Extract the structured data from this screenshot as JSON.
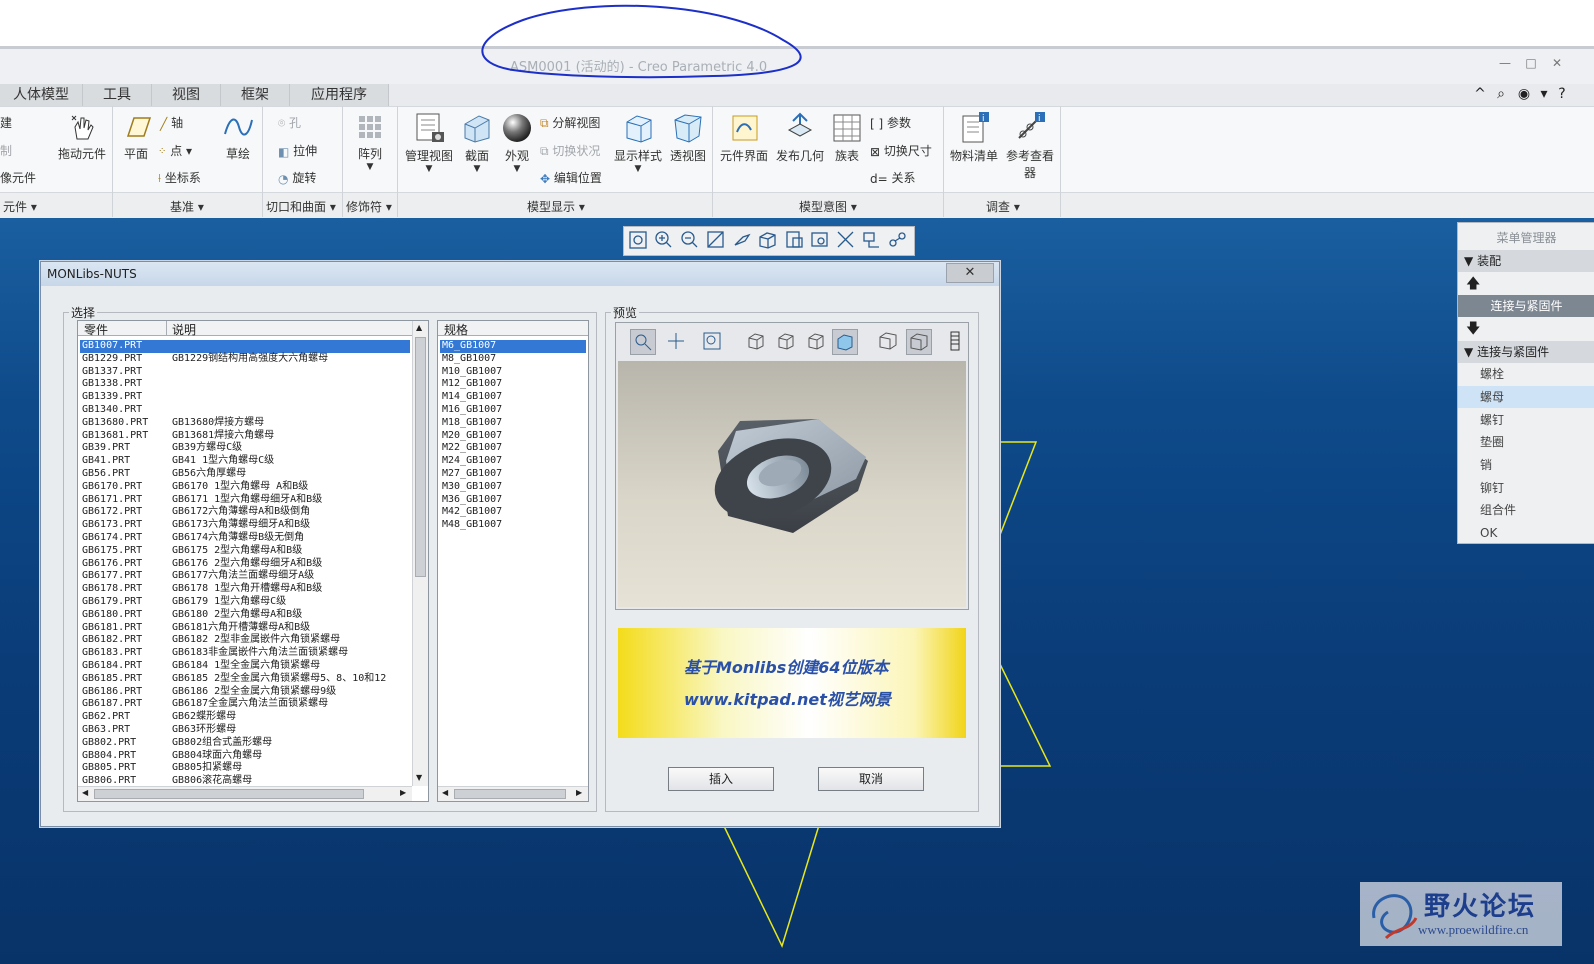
{
  "window": {
    "title": "ASM0001 (活动的) - Creo Parametric 4.0",
    "controls": [
      "—",
      "□",
      "✕"
    ]
  },
  "tabs": [
    "人体模型",
    "工具",
    "视图",
    "框架",
    "应用程序"
  ],
  "right_tools": [
    "^",
    "⌕",
    "◉",
    "▾",
    "?"
  ],
  "ribbon": {
    "left_items": [
      "创建",
      "复制",
      "镜像元件"
    ],
    "group_element": "元件",
    "drag": "拖动元件",
    "plane": "平面",
    "axis": "轴",
    "point": "点",
    "csys": "坐标系",
    "sketch": "草绘",
    "group_datum": "基准",
    "hole": "孔",
    "extrude": "拉伸",
    "revolve": "旋转",
    "group_cut": "切口和曲面",
    "pattern": "阵列",
    "group_modifier": "修饰符",
    "manage_views": "管理视图",
    "section": "截面",
    "appearance": "外观",
    "explode": "分解视图",
    "toggle_status": "切换状况",
    "edit_pos": "编辑位置",
    "display_style": "显示样式",
    "perspective": "透视图",
    "group_display": "模型显示",
    "comp_interface": "元件界面",
    "publish_geom": "发布几何",
    "family_table": "族表",
    "params": "参数",
    "switch_dims": "切换尺寸",
    "relations": "关系",
    "group_intent": "模型意图",
    "bom": "物料清单",
    "ref_viewer_1": "参考查看",
    "ref_viewer_2": "器",
    "group_investigate": "调查"
  },
  "menu_manager": {
    "title": "菜单管理器",
    "assembly": "装配",
    "selected": "连接与紧固件",
    "section": "连接与紧固件",
    "items": [
      "螺栓",
      "螺母",
      "螺钉",
      "垫圈",
      "销",
      "铆钉",
      "组合件",
      "OK"
    ],
    "highlighted_index": 1
  },
  "dialog": {
    "title": "MONLibs-NUTS",
    "close": "✕",
    "select_label": "选择",
    "col_part": "零件",
    "col_desc": "说明",
    "parts": [
      [
        "GB1007.PRT",
        ""
      ],
      [
        "GB1229.PRT",
        "GB1229钢结构用高强度大六角螺母"
      ],
      [
        "GB1337.PRT",
        ""
      ],
      [
        "GB1338.PRT",
        ""
      ],
      [
        "GB1339.PRT",
        ""
      ],
      [
        "GB1340.PRT",
        ""
      ],
      [
        "GB13680.PRT",
        "GB13680焊接方螺母"
      ],
      [
        "GB13681.PRT",
        "GB13681焊接六角螺母"
      ],
      [
        "GB39.PRT",
        "GB39方螺母C级"
      ],
      [
        "GB41.PRT",
        "GB41  1型六角螺母C级"
      ],
      [
        "GB56.PRT",
        "GB56六角厚螺母"
      ],
      [
        "GB6170.PRT",
        "GB6170  1型六角螺母  A和B级"
      ],
      [
        "GB6171.PRT",
        "GB6171  1型六角螺母细牙A和B级"
      ],
      [
        "GB6172.PRT",
        "GB6172六角薄螺母A和B级倒角"
      ],
      [
        "GB6173.PRT",
        "GB6173六角薄螺母细牙A和B级"
      ],
      [
        "GB6174.PRT",
        "GB6174六角薄螺母B级无倒角"
      ],
      [
        "GB6175.PRT",
        "GB6175  2型六角螺母A和B级"
      ],
      [
        "GB6176.PRT",
        "GB6176  2型六角螺母细牙A和B级"
      ],
      [
        "GB6177.PRT",
        "GB6177六角法兰面螺母细牙A级"
      ],
      [
        "GB6178.PRT",
        "GB6178  1型六角开槽螺母A和B级"
      ],
      [
        "GB6179.PRT",
        "GB6179  1型六角螺母C级"
      ],
      [
        "GB6180.PRT",
        "GB6180  2型六角螺母A和B级"
      ],
      [
        "GB6181.PRT",
        "GB6181六角开槽薄螺母A和B级"
      ],
      [
        "GB6182.PRT",
        "GB6182  2型非金属嵌件六角锁紧螺母"
      ],
      [
        "GB6183.PRT",
        "GB6183非金属嵌件六角法兰面锁紧螺母"
      ],
      [
        "GB6184.PRT",
        "GB6184  1型全金属六角锁紧螺母"
      ],
      [
        "GB6185.PRT",
        "GB6185  2型全金属六角锁紧螺母5、8、10和12"
      ],
      [
        "GB6186.PRT",
        "GB6186  2型全金属六角锁紧螺母9级"
      ],
      [
        "GB6187.PRT",
        "GB6187全金属六角法兰面锁紧螺母"
      ],
      [
        "GB62.PRT",
        "GB62蝶形螺母"
      ],
      [
        "GB63.PRT",
        "GB63环形螺母"
      ],
      [
        "GB802.PRT",
        "GB802组合式盖形螺母"
      ],
      [
        "GB804.PRT",
        "GB804球面六角螺母"
      ],
      [
        "GB805.PRT",
        "GB805扣紧螺母"
      ],
      [
        "GB806.PRT",
        "GB806滚花高螺母"
      ]
    ],
    "selected_part_index": 0,
    "spec_label": "规格",
    "specs": [
      "M6_GB1007",
      "M8_GB1007",
      "M10_GB1007",
      "M12_GB1007",
      "M14_GB1007",
      "M16_GB1007",
      "M18_GB1007",
      "M20_GB1007",
      "M22_GB1007",
      "M24_GB1007",
      "M27_GB1007",
      "M30_GB1007",
      "M36_GB1007",
      "M42_GB1007",
      "M48_GB1007"
    ],
    "selected_spec_index": 0,
    "preview_label": "预览",
    "ad_line1": "基于Monlibs创建64位版本",
    "ad_line2": "www.kitpad.net视艺网景",
    "insert": "插入",
    "cancel": "取消"
  },
  "watermark": {
    "name": "野火论坛",
    "url": "www.proewildfire.cn"
  },
  "colors": {
    "workspace": "#0e4a8a",
    "selection": "#3478d6",
    "title_circle": "#1c2fc8",
    "datum_lines": "#e8e81a"
  }
}
